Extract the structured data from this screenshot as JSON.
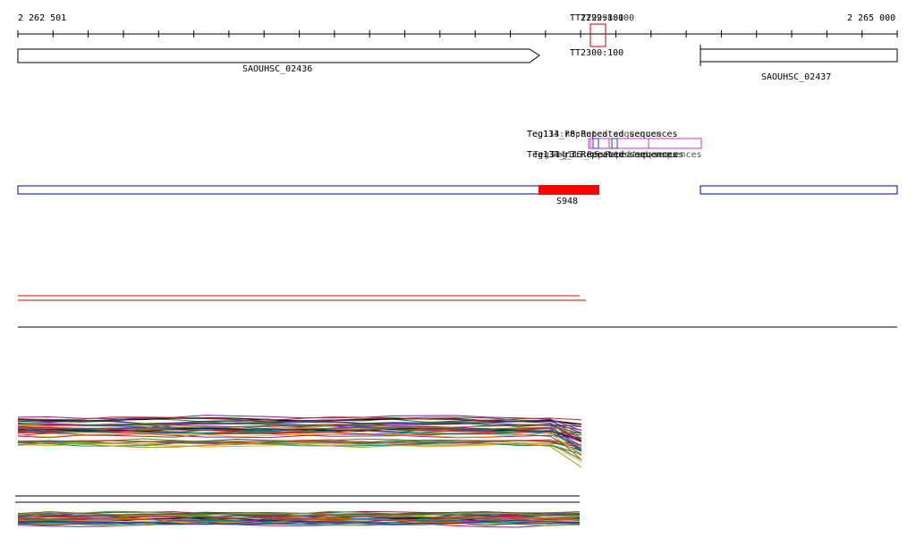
{
  "scale": {
    "start_label": "2 262 501",
    "end_label": "2 265 000",
    "start": 2262501,
    "end": 2265000,
    "tick_count": 26
  },
  "genes": [
    {
      "name": "SAOUHSC_02436",
      "strand": "+",
      "start": 2262501,
      "end": 2263983,
      "label_row": "main"
    },
    {
      "name": "SAOUHSC_02437",
      "strand": "-",
      "start": 2264419,
      "end": 2265000,
      "label_row": "lower"
    }
  ],
  "terminators": {
    "start": 2264093,
    "end": 2264137,
    "labels": [
      "TT2299:100",
      "TT2298:100",
      "TT2300:100"
    ]
  },
  "repeats": {
    "top_labels": [
      "Teg134_r8:Repeated sequences",
      "Teg113:Repeated sequences"
    ],
    "bottom_labels": [
      "Teg134_r3:Repeated sequences",
      "Teg134_r6:Repeated sequences",
      "Teg113_r5:Repeated sequences"
    ],
    "boxes": [
      {
        "start": 2264093,
        "end": 2264413,
        "row": 0
      },
      {
        "start": 2264110,
        "end": 2264180,
        "row": 0
      },
      {
        "start": 2264120,
        "end": 2264150,
        "row": 0
      },
      {
        "start": 2264155,
        "end": 2264255,
        "row": 0
      },
      {
        "start": 2264175,
        "end": 2264200,
        "row": 0
      },
      {
        "start": 2264200,
        "end": 2264300,
        "row": 0
      }
    ]
  },
  "features": {
    "outline_boxes": [
      {
        "start": 2262501,
        "end": 2263983
      },
      {
        "start": 2264419,
        "end": 2265000
      }
    ],
    "highlight": {
      "name": "S948",
      "start": 2263983,
      "end": 2264155,
      "color": "#ff0000"
    }
  },
  "colors": {
    "axis": "#000000",
    "terminator": "#cc0000",
    "repeat": "#cc33cc",
    "repeat_accent": "#3333cc",
    "feature_outline": "#000099",
    "red_track": "#ff0000"
  }
}
